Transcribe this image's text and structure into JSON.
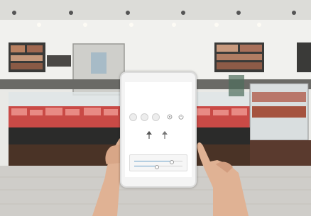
{
  "scene": {
    "description_tags": [
      "supermarket-deli",
      "tablet-app",
      "hands"
    ],
    "colors": {
      "ceiling": "#dcdcd8",
      "wall": "#f1f1ee",
      "counter_dark": "#2b2b2a",
      "meat_red": "#c94a46",
      "floor": "#cfcdc9",
      "menu_board": "#3a3a38"
    }
  },
  "tablet_app": {
    "title": "",
    "control_icons": [
      "mode-icon",
      "mode-icon",
      "mode-icon",
      "settings-icon",
      "power-icon"
    ],
    "lamp_icons": [
      "lamp-icon",
      "lamp-icon"
    ],
    "sliders": [
      {
        "level": 0.75
      },
      {
        "level": 0.45
      }
    ]
  }
}
